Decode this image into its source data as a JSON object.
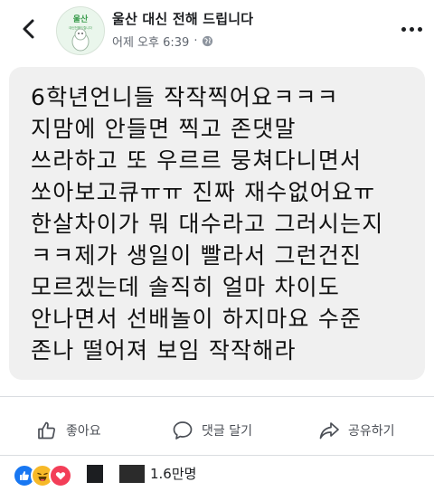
{
  "header": {
    "page_name": "울산 대신 전해 드립니다",
    "timestamp": "어제 오후 6:39",
    "separator": "·",
    "avatar_text_top": "울산",
    "avatar_text_bottom": "대신전해드립니다"
  },
  "post": {
    "lines": [
      "6학년언니들 작작찍어요ㅋㅋㅋ",
      "지맘에 안들면 찍고 존댓말",
      "쓰라하고 또 우르르 뭉쳐다니면서",
      "쏘아보고큐ㅠㅠ 진짜 재수없어요ㅠ",
      "한살차이가 뭐 대수라고 그러시는지",
      "ㅋㅋ제가 생일이 빨라서 그런건진",
      "모르겠는데 솔직히 얼마 차이도",
      "안나면서 선배놀이 하지마요 수준",
      "존나 떨어져 보임 작작해라"
    ],
    "bubble_color": "#f0f0f0"
  },
  "actions": {
    "like_label": "좋아요",
    "comment_label": "댓글 달기",
    "share_label": "공유하기"
  },
  "reactions": {
    "icons": [
      "like-reaction",
      "haha-reaction",
      "love-reaction"
    ],
    "count_label": "1.6만명",
    "colors": {
      "like": "#1877f2",
      "haha": "#f7b928",
      "love": "#f33e58"
    }
  }
}
